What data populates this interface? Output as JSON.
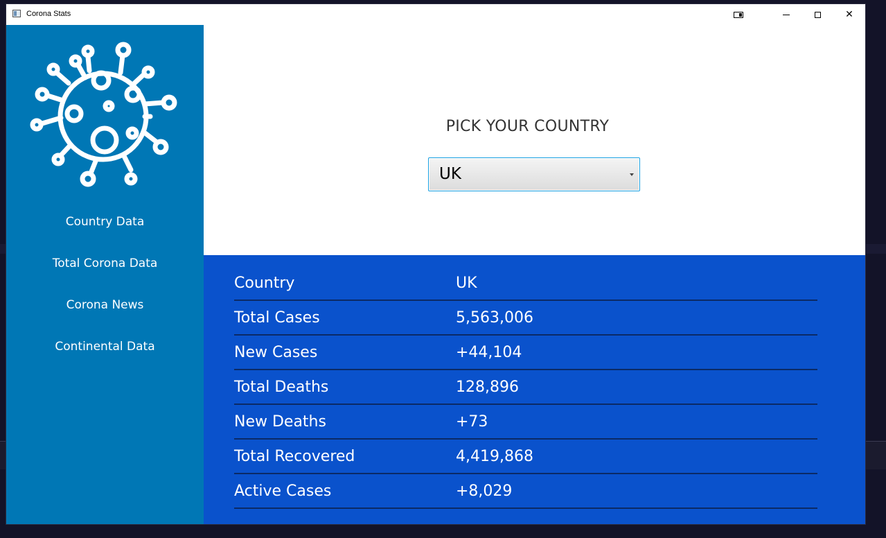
{
  "window": {
    "title": "Corona Stats"
  },
  "titlebar_buttons": {
    "minimize_icon": "minimize-icon",
    "maximize_icon": "maximize-icon",
    "close_icon": "close-icon",
    "close_glyph": "✕"
  },
  "sidebar": {
    "background": "#0077b5",
    "logo_icon": "virus-icon",
    "items": [
      {
        "label": "Country Data"
      },
      {
        "label": "Total Corona Data"
      },
      {
        "label": "Corona News"
      },
      {
        "label": "Continental Data"
      }
    ]
  },
  "main": {
    "heading": "PICK YOUR COUNTRY",
    "country_select": {
      "selected": "UK"
    }
  },
  "stats": {
    "background": "#0a52cc",
    "rows": [
      {
        "label": "Country",
        "value": "UK"
      },
      {
        "label": "Total Cases",
        "value": "5,563,006"
      },
      {
        "label": "New Cases",
        "value": "+44,104"
      },
      {
        "label": "Total Deaths",
        "value": "128,896"
      },
      {
        "label": "New Deaths",
        "value": "+73"
      },
      {
        "label": "Total Recovered",
        "value": "4,419,868"
      },
      {
        "label": "Active Cases",
        "value": "+8,029"
      }
    ]
  }
}
